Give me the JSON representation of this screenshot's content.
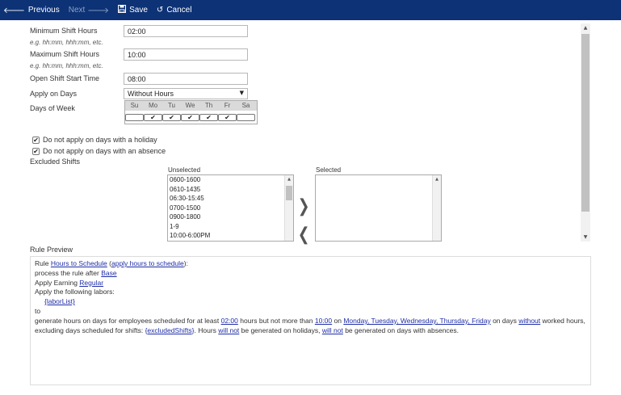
{
  "toolbar": {
    "previous_label": "Previous",
    "next_label": "Next",
    "save_label": "Save",
    "cancel_label": "Cancel"
  },
  "form": {
    "min_hours": {
      "label": "Minimum Shift Hours",
      "hint": "e.g. hh:mm, hhh:mm, etc.",
      "value": "02:00"
    },
    "max_hours": {
      "label": "Maximum Shift Hours",
      "hint": "e.g. hh:mm, hhh:mm, etc.",
      "value": "10:00"
    },
    "open_shift_start": {
      "label": "Open Shift Start Time",
      "value": "08:00"
    },
    "apply_on_days": {
      "label": "Apply on Days",
      "selected": "Without Hours"
    },
    "days_of_week": {
      "label": "Days of Week",
      "days": [
        {
          "abbr": "Su",
          "checked": false
        },
        {
          "abbr": "Mo",
          "checked": true
        },
        {
          "abbr": "Tu",
          "checked": true
        },
        {
          "abbr": "We",
          "checked": true
        },
        {
          "abbr": "Th",
          "checked": true
        },
        {
          "abbr": "Fr",
          "checked": true
        },
        {
          "abbr": "Sa",
          "checked": false
        }
      ]
    },
    "no_holiday": {
      "label": "Do not apply on days with a holiday",
      "checked": true
    },
    "no_absence": {
      "label": "Do not apply on days with an absence",
      "checked": true
    },
    "excluded_shifts": {
      "label": "Excluded Shifts",
      "unselected_label": "Unselected",
      "selected_label": "Selected",
      "unselected": [
        "0600-1600",
        "0610-1435",
        "06:30-15:45",
        "0700-1500",
        "0900-1800",
        "1-9",
        "10:00-6:00PM"
      ],
      "selected": []
    }
  },
  "preview": {
    "label": "Rule Preview",
    "rule_prefix": "Rule ",
    "rule_name": "Hours to Schedule",
    "rule_code_open": " (",
    "rule_code": "apply hours to schedule",
    "rule_code_close": "):",
    "after_prefix": "process the rule after ",
    "after_rule": "Base",
    "earning_prefix": "Apply Earning ",
    "earning": "Regular",
    "labors_prefix": "Apply the following labors:",
    "labor_list": "{laborList}",
    "to": "to",
    "gen_1": "generate hours on days for employees scheduled for at least ",
    "min": "02:00",
    "gen_2": " hours but not more than ",
    "max": "10:00",
    "gen_3": " on ",
    "days": "Monday, Tuesday, Wednesday, Thursday, Friday",
    "gen_4": " on days ",
    "without": "without",
    "gen_5": " worked hours, excluding days scheduled for shifts: ",
    "excluded": "{excludedShifts}",
    "gen_6": ". Hours ",
    "will_not_1": "will not",
    "gen_7": " be generated on holidays, ",
    "will_not_2": "will not",
    "gen_8": " be generated on days with absences."
  },
  "colors": {
    "toolbar_bg": "#0d3276",
    "link": "#1f2ea8"
  }
}
